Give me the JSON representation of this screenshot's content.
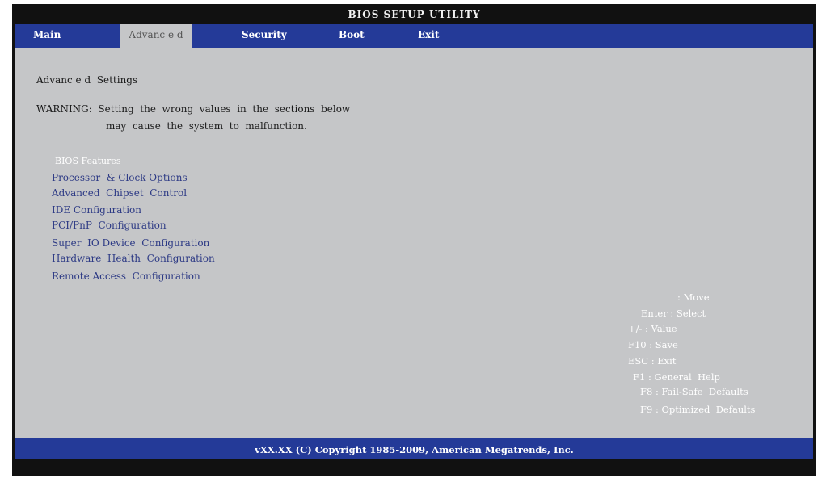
{
  "title": "BIOS SETUP UTILITY",
  "tabs": [
    "Main",
    "Advanc e d",
    "Security",
    "Boot",
    "Exit"
  ],
  "heading": "Advanc e d  Settings",
  "warning_line1": "WARNING:  Setting  the  wrong  values  in  the  sections  below",
  "warning_line2": "may  cause  the  system  to  malfunction.",
  "menu_items": [
    "BIOS Features",
    "Processor  & Clock Options",
    "Advanced  Chipset  Control",
    "IDE Configuration",
    "PCI/PnP  Configuration",
    "Super  IO Device  Configuration",
    "Hardware  Health  Configuration",
    "Remote Access  Configuration"
  ],
  "help": [
    ": Move",
    "Enter : Select",
    "+/- : Value",
    "F10 : Save",
    "ESC : Exit",
    "F1 : General  Help",
    "F8 : Fail-Safe  Defaults",
    "F9 : Optimized  Defaults"
  ],
  "footer": "vXX.XX  (C)  Copyright   1985-2009,   American  Megatrends,   Inc.",
  "colors": {
    "frame": "#111111",
    "bar": "#243a98",
    "panel": "#c5c6c8",
    "item_text": "#2d3a85"
  }
}
